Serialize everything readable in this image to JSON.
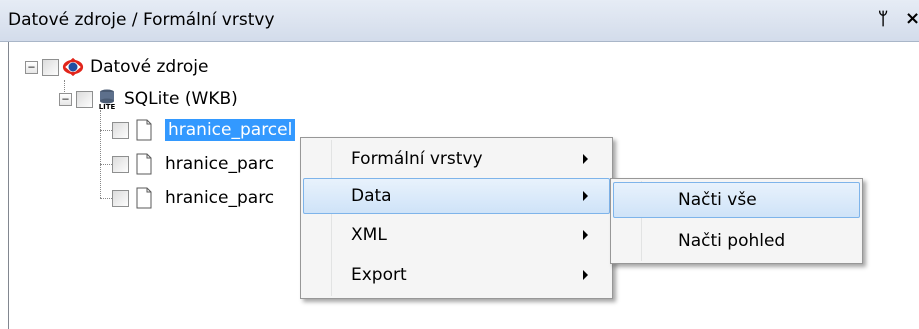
{
  "panel": {
    "title": "Datové zdroje / Formální vrstvy",
    "pin_glyph": "ᛘ",
    "close_glyph": "×"
  },
  "tree": {
    "root": {
      "label": "Datové zdroje",
      "expander": "−",
      "icon": "datasource-icon"
    },
    "sqlite": {
      "label": "SQLite (WKB)",
      "expander": "−",
      "icon": "database-lite-icon"
    },
    "layers": [
      {
        "label": "hranice_parcel",
        "icon": "document-icon",
        "selected": true
      },
      {
        "label": "hranice_parc",
        "icon": "document-icon",
        "selected": false
      },
      {
        "label": "hranice_parc",
        "icon": "document-icon",
        "selected": false
      }
    ]
  },
  "context_menu": {
    "items": [
      {
        "label": "Formální vrstvy",
        "has_submenu": true
      },
      {
        "label": "Data",
        "has_submenu": true,
        "hover": true
      },
      {
        "label": "XML",
        "has_submenu": true
      },
      {
        "label": "Export",
        "has_submenu": true
      }
    ]
  },
  "submenu": {
    "items": [
      {
        "label": "Načti vše",
        "hover": true
      },
      {
        "label": "Načti pohled"
      }
    ]
  },
  "colors": {
    "selection": "#3399ff",
    "menu_hover_border": "#7eb4ea"
  }
}
